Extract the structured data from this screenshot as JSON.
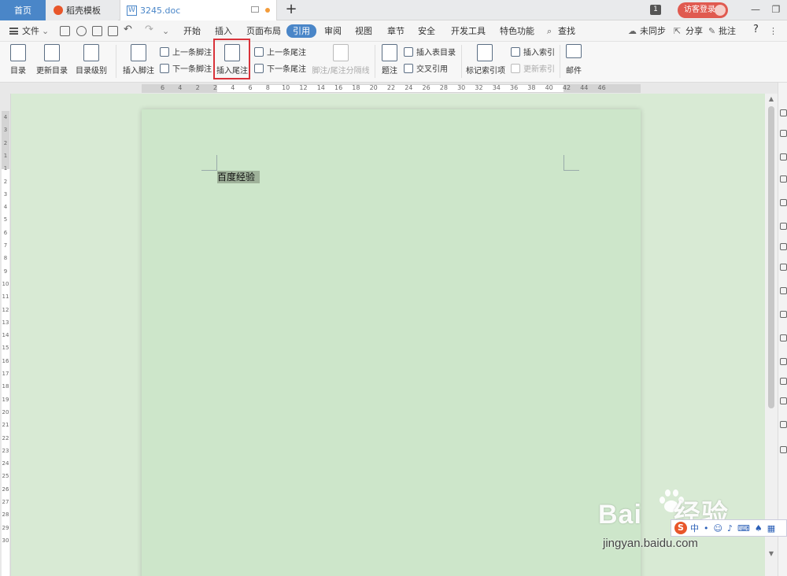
{
  "tabs": {
    "home": "首页",
    "template": "稻壳模板",
    "doc": "3245.doc",
    "new_tab": "+",
    "badge": "1",
    "login": "访客登录"
  },
  "window_controls": {
    "minimize": "—",
    "restore": "❐"
  },
  "menu": {
    "file": "文件",
    "items": [
      "开始",
      "插入",
      "页面布局",
      "引用",
      "审阅",
      "视图",
      "章节",
      "安全",
      "开发工具",
      "特色功能"
    ],
    "active": "引用",
    "search": "查找",
    "sync": "未同步",
    "share": "分享",
    "comment": "批注",
    "help": "?"
  },
  "ribbon": {
    "toc": "目录",
    "update_toc": "更新目录",
    "toc_level": "目录级别",
    "insert_footnote": "插入脚注",
    "prev_footnote": "上一条脚注",
    "next_footnote": "下一条脚注",
    "insert_endnote": "插入尾注",
    "prev_endnote": "上一条尾注",
    "next_endnote": "下一条尾注",
    "separator": "脚注/尾注分隔线",
    "caption": "题注",
    "insert_table_of_figures": "插入表目录",
    "cross_reference": "交叉引用",
    "mark_index": "标记索引项",
    "insert_index": "插入索引",
    "update_index": "更新索引",
    "mail": "邮件"
  },
  "ruler": {
    "h_ticks": [
      "6",
      "4",
      "2",
      "2",
      "4",
      "6",
      "8",
      "10",
      "12",
      "14",
      "16",
      "18",
      "20",
      "22",
      "24",
      "26",
      "28",
      "30",
      "32",
      "34",
      "36",
      "38",
      "40",
      "42",
      "44",
      "46"
    ],
    "v_ticks": [
      "4",
      "3",
      "2",
      "1",
      "1",
      "2",
      "3",
      "4",
      "5",
      "6",
      "7",
      "8",
      "9",
      "10",
      "11",
      "12",
      "13",
      "14",
      "15",
      "16",
      "17",
      "18",
      "19",
      "20",
      "21",
      "22",
      "23",
      "24",
      "25",
      "26",
      "27",
      "28",
      "29",
      "30"
    ]
  },
  "document": {
    "selected_text": "百度经验"
  },
  "watermark": {
    "brand": "Bai",
    "brand2": "经验",
    "url": "jingyan.baidu.com"
  },
  "ime": {
    "logo": "S",
    "mode": "中"
  },
  "colors": {
    "accent": "#4a86c8",
    "page_bg": "#cde6ca",
    "canvas_bg": "#d8ead4",
    "highlight_box": "#d9333a",
    "login_btn": "#e05a50"
  }
}
